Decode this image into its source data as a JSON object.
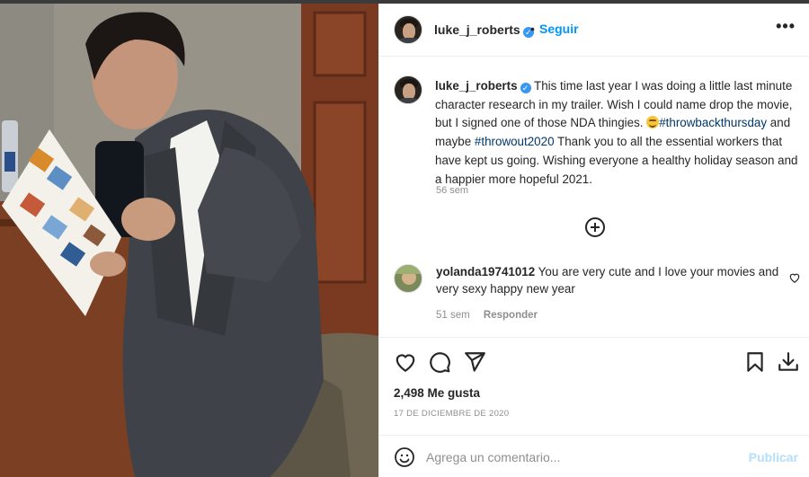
{
  "post": {
    "username": "luke_j_roberts",
    "verified_icon": "verified-badge-icon",
    "separator": "•",
    "follow_label": "Seguir",
    "more_icon": "more-options-icon",
    "more_glyph": "•••"
  },
  "caption": {
    "username": "luke_j_roberts",
    "text_1": " This time last year I was doing a little last minute character research in my trailer. Wish I could name drop the movie, but I signed one of those NDA thingies. ",
    "emoji": "grinning-face-emoji",
    "hashtag_1": "#throwbackthursday",
    "text_2": " and maybe ",
    "hashtag_2": "#throwout2020",
    "text_3": " Thank you to all the essential workers that have kept us going. Wishing everyone a healthy holiday season and a happier more hopeful 2021.",
    "time": "56 sem"
  },
  "load_more_icon": "add-circle-icon",
  "comment": {
    "username": "yolanda19741012",
    "text": " You are very cute and I love your movies and very sexy happy new year",
    "time": "51 sem",
    "reply_label": "Responder"
  },
  "actions": {
    "like_icon": "heart-icon",
    "comment_icon": "comment-icon",
    "share_icon": "share-icon",
    "save_icon": "bookmark-icon",
    "download_icon": "download-icon"
  },
  "likes": "2,498 Me gusta",
  "date": "17 DE DICIEMBRE DE 2020",
  "comment_box": {
    "emoji_icon": "smiley-icon",
    "placeholder": "Agrega un comentario...",
    "publish_label": "Publicar"
  },
  "colors": {
    "accent": "#0095f6",
    "hashtag": "#00376b",
    "muted": "#8e8e8e",
    "publish_disabled": "#b2dffc"
  }
}
